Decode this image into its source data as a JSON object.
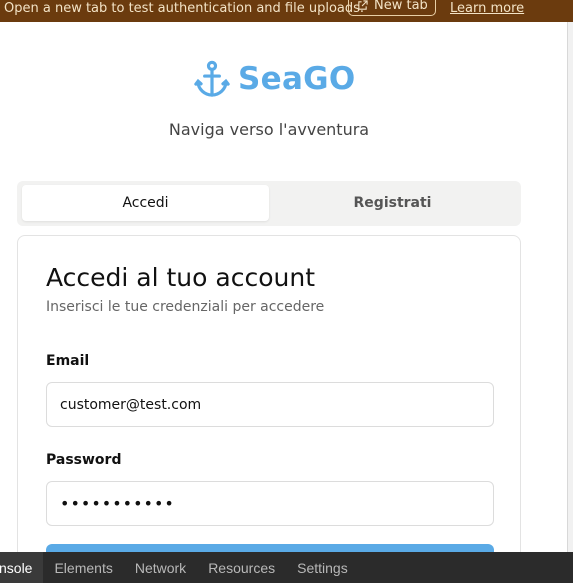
{
  "banner": {
    "text": "Open a new tab to test authentication and file uploads.",
    "new_tab_label": "New tab",
    "learn_more_label": "Learn more"
  },
  "brand": {
    "name": "SeaGO",
    "tagline": "Naviga verso l'avventura",
    "icon": "anchor-icon",
    "accent_color": "#5aaae6"
  },
  "tabs": [
    {
      "label": "Accedi",
      "active": true
    },
    {
      "label": "Registrati",
      "active": false
    }
  ],
  "login": {
    "title": "Accedi al tuo account",
    "subtitle": "Inserisci le tue credenziali per accedere",
    "email_label": "Email",
    "email_value": "customer@test.com",
    "password_label": "Password",
    "password_value": "•••••••••••"
  },
  "devtools": {
    "tabs": [
      "nsole",
      "Elements",
      "Network",
      "Resources",
      "Settings"
    ]
  }
}
